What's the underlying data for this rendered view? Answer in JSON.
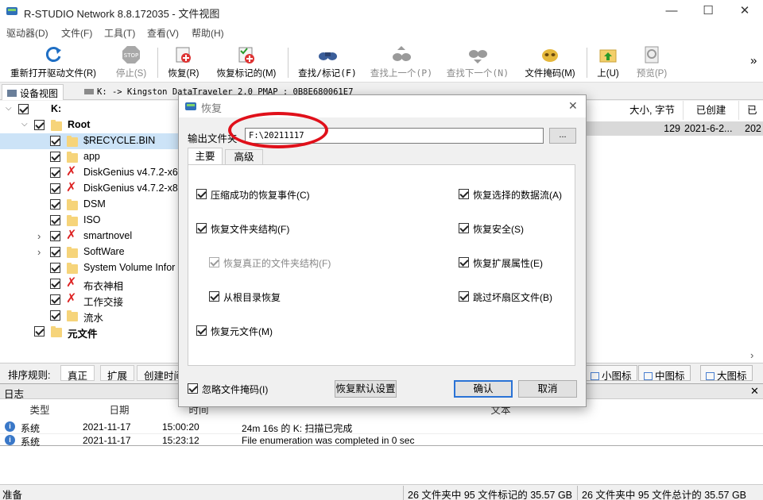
{
  "window": {
    "title": "R-STUDIO Network 8.8.172035 - 文件视图",
    "minimize": "—",
    "maximize": "☐",
    "close": "✕"
  },
  "menu": [
    "驱动器(D)",
    "文件(F)",
    "工具(T)",
    "查看(V)",
    "帮助(H)"
  ],
  "toolbar": {
    "reopen": "重新打开驱动文件(R)",
    "stop": "停止(S)",
    "recover": "恢复(R)",
    "recover_marked": "恢复标记的(M)",
    "find_mark": "查找/标记(F)",
    "find_prev": "查找上一个(P)",
    "find_next": "查找下一个(N)",
    "file_mask": "文件掩码(M)",
    "up": "上(U)",
    "preview": "预览(P)",
    "more": "»",
    "stop_sign": "STOP"
  },
  "tabs": {
    "device_view": "设备视图",
    "drive_tab": "K: -> Kingston DataTraveler 2.0 PMAP : 0B8E680061E7"
  },
  "tree": {
    "drive": "K:",
    "root": "Root",
    "items": [
      {
        "label": "$RECYCLE.BIN",
        "bad": false,
        "expander": ""
      },
      {
        "label": "app",
        "bad": false,
        "expander": ""
      },
      {
        "label": "DiskGenius v4.7.2-x6",
        "bad": true,
        "expander": ""
      },
      {
        "label": "DiskGenius v4.7.2-x8",
        "bad": true,
        "expander": ""
      },
      {
        "label": "DSM",
        "bad": false,
        "expander": ""
      },
      {
        "label": "ISO",
        "bad": false,
        "expander": ""
      },
      {
        "label": "smartnovel",
        "bad": true,
        "expander": "›"
      },
      {
        "label": "SoftWare",
        "bad": false,
        "expander": "›"
      },
      {
        "label": "System Volume Infor",
        "bad": false,
        "expander": ""
      },
      {
        "label": "布衣神相",
        "bad": true,
        "expander": ""
      },
      {
        "label": "工作交接",
        "bad": true,
        "expander": ""
      },
      {
        "label": "流水",
        "bad": false,
        "expander": ""
      }
    ],
    "metafiles": "元文件"
  },
  "right_pane": {
    "col_size": "大小, 字节",
    "col_created": "已创建",
    "col_more": "已",
    "row_size": "129",
    "row_created": "2021-6-2...",
    "row_more": "202"
  },
  "sortbar": {
    "label": "排序规则:",
    "sort_name": "真正",
    "sort_ext": "扩展",
    "sort_created": "创建时间",
    "small_icons": "小图标",
    "medium_icons": "中图标",
    "large_icons": "大图标"
  },
  "log": {
    "title": "日志",
    "close": "✕",
    "columns": [
      "类型",
      "日期",
      "时间",
      "文本"
    ],
    "rows": [
      {
        "type": "系统",
        "date": "2021-11-17",
        "time": "15:00:20",
        "text": "24m 16s 的 K: 扫描已完成"
      },
      {
        "type": "系统",
        "date": "2021-11-17",
        "time": "15:23:12",
        "text": "File enumeration was completed in 0 sec"
      }
    ]
  },
  "status": {
    "ready": "准备",
    "marked": "26 文件夹中 95 文件标记的 35.57 GB",
    "total": "26 文件夹中 95 文件总计的 35.57 GB"
  },
  "dialog": {
    "title": "恢复",
    "close": "✕",
    "output_label": "输出文件夹",
    "output_value": "F:\\20211117",
    "browse": "...",
    "tab_main": "主要",
    "tab_advanced": "高级",
    "left_options": [
      {
        "label": "压缩成功的恢复事件(C)",
        "checked": true,
        "dim": false
      },
      {
        "label": "恢复文件夹结构(F)",
        "checked": true,
        "dim": false
      },
      {
        "label": "恢复真正的文件夹结构(F)",
        "checked": true,
        "dim": true
      },
      {
        "label": "从根目录恢复",
        "checked": true,
        "dim": false
      },
      {
        "label": "恢复元文件(M)",
        "checked": true,
        "dim": false
      }
    ],
    "right_options": [
      {
        "label": "恢复选择的数据流(A)",
        "checked": true
      },
      {
        "label": "恢复安全(S)",
        "checked": true
      },
      {
        "label": "恢复扩展属性(E)",
        "checked": true
      },
      {
        "label": "跳过坏扇区文件(B)",
        "checked": true
      }
    ],
    "ignore_mask": "忽略文件掩码(I)",
    "restore_defaults": "恢复默认设置",
    "ok": "确认",
    "cancel": "取消"
  },
  "colors": {
    "accent": "#2a73d6",
    "annotation_red": "#e0101a",
    "folder": "#f6d47a",
    "bad_mark": "#dd2222"
  }
}
